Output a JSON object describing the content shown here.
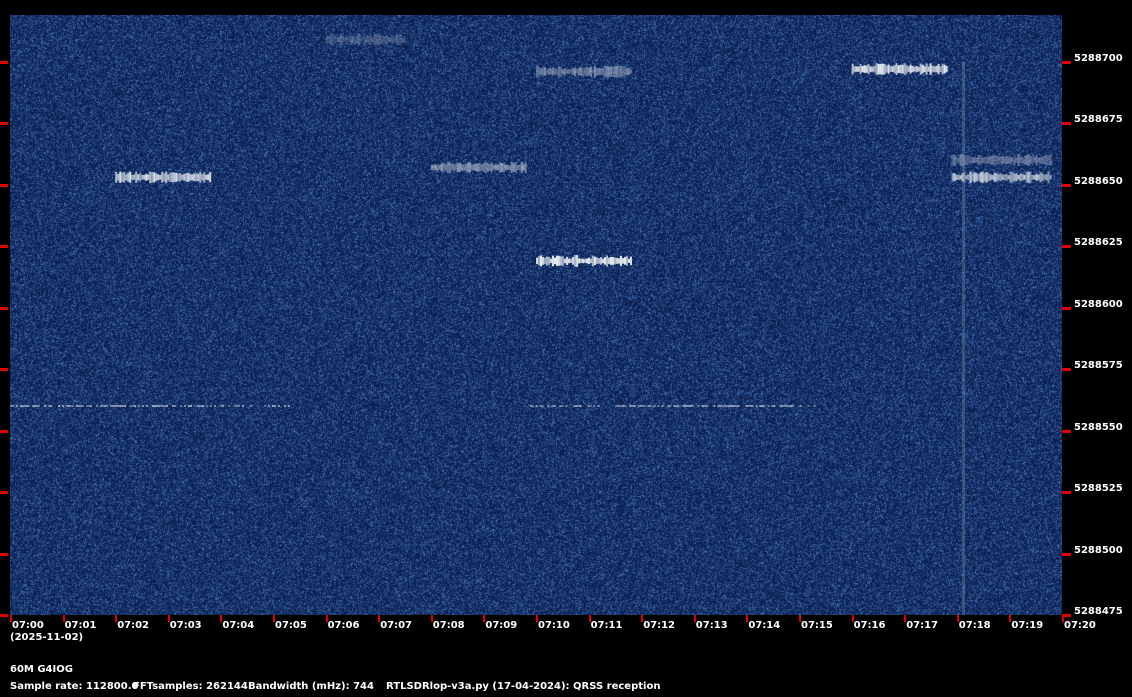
{
  "chart_data": {
    "type": "heatmap",
    "title": "60M G4IOG",
    "xlabel": "(2025-11-02)",
    "x_ticks": [
      "07:00",
      "07:01",
      "07:02",
      "07:03",
      "07:04",
      "07:05",
      "07:06",
      "07:07",
      "07:08",
      "07:09",
      "07:10",
      "07:11",
      "07:12",
      "07:13",
      "07:14",
      "07:15",
      "07:16",
      "07:17",
      "07:18",
      "07:19",
      "07:20"
    ],
    "xlim_minutes": [
      0,
      20
    ],
    "y_ticks": [
      "5288700",
      "5288675",
      "5288650",
      "5288625",
      "5288600",
      "5288575",
      "5288550",
      "5288525",
      "5288500",
      "5288475"
    ],
    "ylim_hz": [
      5288475,
      5288719
    ],
    "colors": {
      "background": "#0a2260",
      "signal": "#e8ecf0",
      "tick": "#e00000"
    },
    "signals": [
      {
        "start": 2.0,
        "end": 3.8,
        "freq": 5288653,
        "intensity": 0.95
      },
      {
        "start": 8.0,
        "end": 9.8,
        "freq": 5288657,
        "intensity": 0.55
      },
      {
        "start": 10.0,
        "end": 11.8,
        "freq": 5288619,
        "intensity": 1.0
      },
      {
        "start": 10.0,
        "end": 11.8,
        "freq": 5288696,
        "intensity": 0.45
      },
      {
        "start": 16.0,
        "end": 17.8,
        "freq": 5288697,
        "intensity": 1.0
      },
      {
        "start": 17.9,
        "end": 19.8,
        "freq": 5288653,
        "intensity": 0.8
      },
      {
        "start": 17.9,
        "end": 19.8,
        "freq": 5288660,
        "intensity": 0.4
      },
      {
        "start": 6.0,
        "end": 7.5,
        "freq": 5288709,
        "intensity": 0.25
      },
      {
        "start": 0.0,
        "end": 5.3,
        "freq": 5288560,
        "intensity": 0.6,
        "dashed": true
      },
      {
        "start": 9.8,
        "end": 15.3,
        "freq": 5288560,
        "intensity": 0.6,
        "dashed": true
      }
    ],
    "vertical_lines": [
      {
        "time": 18.1,
        "intensity": 0.3
      }
    ]
  },
  "footer": {
    "station": "60M G4IOG",
    "sample_rate": "Sample rate: 112800.0",
    "fft": "FFTsamples: 262144",
    "bandwidth": "Bandwidth (mHz): 744",
    "software": "RTLSDRlop-v3a.py (17-04-2024): QRSS reception"
  }
}
